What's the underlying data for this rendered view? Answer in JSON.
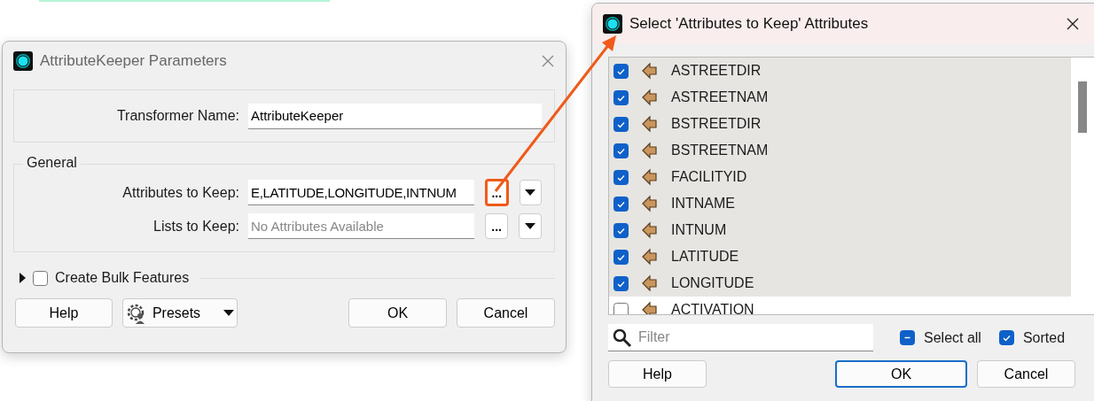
{
  "parameters_window": {
    "title": "AttributeKeeper Parameters",
    "transformer_name": {
      "label": "Transformer Name:",
      "value": "AttributeKeeper"
    },
    "general": {
      "title": "General",
      "fields": [
        {
          "label": "Attributes to Keep:",
          "value": "E,LATITUDE,LONGITUDE,INTNUM",
          "highlighted": true,
          "browse": "..."
        },
        {
          "label": "Lists to Keep:",
          "placeholder": "No Attributes Available",
          "highlighted": false,
          "browse": "..."
        }
      ]
    },
    "bulk_features": {
      "label": "Create Bulk Features",
      "checked": false,
      "expanded": false
    },
    "buttons": [
      {
        "kind": "plain",
        "label": "Help"
      },
      {
        "kind": "menu",
        "label": "Presets"
      },
      {
        "kind": "plain",
        "label": "OK"
      },
      {
        "kind": "plain",
        "label": "Cancel"
      }
    ]
  },
  "select_window": {
    "title": "Select 'Attributes to Keep' Attributes",
    "attributes": [
      {
        "name": "ASTREETDIR",
        "checked": true
      },
      {
        "name": "ASTREETNAM",
        "checked": true
      },
      {
        "name": "BSTREETDIR",
        "checked": true
      },
      {
        "name": "BSTREETNAM",
        "checked": true
      },
      {
        "name": "FACILITYID",
        "checked": true
      },
      {
        "name": "INTNAME",
        "checked": true
      },
      {
        "name": "INTNUM",
        "checked": true
      },
      {
        "name": "LATITUDE",
        "checked": true
      },
      {
        "name": "LONGITUDE",
        "checked": true
      },
      {
        "name": "ACTIVATION",
        "checked": false
      }
    ],
    "filter": {
      "placeholder": "Filter"
    },
    "select_all": {
      "label": "Select all",
      "checked": false,
      "partial": true
    },
    "sorted": {
      "label": "Sorted",
      "checked": true
    },
    "buttons": [
      {
        "label": "Help",
        "default": false
      },
      {
        "label": "OK",
        "default": true
      },
      {
        "label": "Cancel",
        "default": false
      }
    ]
  }
}
